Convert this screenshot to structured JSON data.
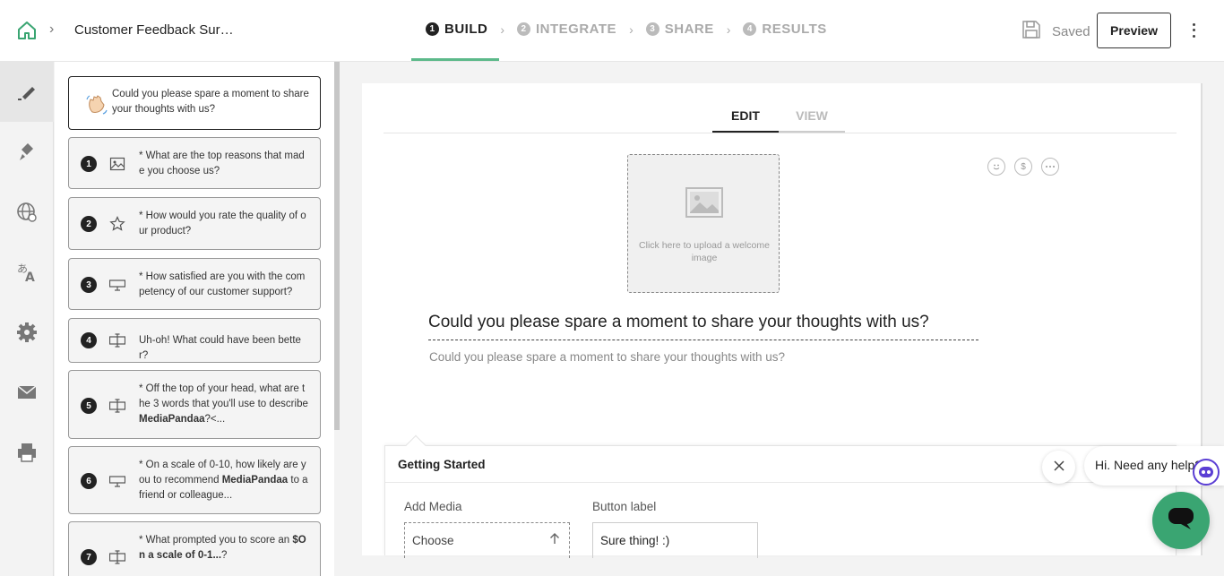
{
  "header": {
    "survey_title": "Customer Feedback Sur…",
    "steps": [
      {
        "num": "1",
        "label": "BUILD"
      },
      {
        "num": "2",
        "label": "INTEGRATE"
      },
      {
        "num": "3",
        "label": "SHARE"
      },
      {
        "num": "4",
        "label": "RESULTS"
      }
    ],
    "active_step": "BUILD",
    "saved_label": "Saved",
    "preview_label": "Preview"
  },
  "rail": {
    "items": [
      "build-icon",
      "paint-icon",
      "globe-icon",
      "translate-icon",
      "settings-icon",
      "mail-icon",
      "print-icon"
    ],
    "active": "build-icon"
  },
  "questions": {
    "welcome": "Could you please spare a moment to share your thoughts with us?",
    "items": [
      {
        "num": "1",
        "icon": "image-icon",
        "text": "* What are the top reasons that made you choose us?"
      },
      {
        "num": "2",
        "icon": "star-icon",
        "text": "* How would you rate the quality of our product?"
      },
      {
        "num": "3",
        "icon": "monitor-icon",
        "text": "* How satisfied are you with the competency of our customer support?"
      },
      {
        "num": "4",
        "icon": "text-field-icon",
        "text": "Uh-oh! What could have been better?"
      },
      {
        "num": "5",
        "icon": "text-field-icon",
        "text_pre": "* Off the top of your head, what are the 3 words that you'll use to describe ",
        "text_bold": "MediaPandaa",
        "text_post": "?<..."
      },
      {
        "num": "6",
        "icon": "monitor-icon",
        "text_pre": "* On a scale of 0-10, how likely are you to recommend ",
        "text_bold": "MediaPandaa",
        "text_post": " to a friend or colleague..."
      },
      {
        "num": "7",
        "icon": "text-field-icon",
        "text_pre": "* What prompted you to score an ",
        "text_bold": "$On a scale of 0-1...",
        "text_post": "?"
      }
    ]
  },
  "editor": {
    "tabs": [
      "EDIT",
      "VIEW"
    ],
    "active_tab": "EDIT",
    "upload_text": "Click here to upload a welcome image",
    "mini_icons": [
      "smiley-icon",
      "dollar-icon",
      "more-icon"
    ],
    "dollar_glyph": "$",
    "welcome_title": "Could you please spare a moment to share your thoughts with us?",
    "welcome_subtitle": "Could you please spare a moment to share your thoughts with us?"
  },
  "getting_started": {
    "title": "Getting Started",
    "add_media_label": "Add Media",
    "choose_label": "Choose",
    "button_label_label": "Button label",
    "button_label_value": "Sure thing! :)"
  },
  "chat": {
    "bubble_text": "Hi. Need any help?",
    "brand_color": "#3aa572"
  }
}
